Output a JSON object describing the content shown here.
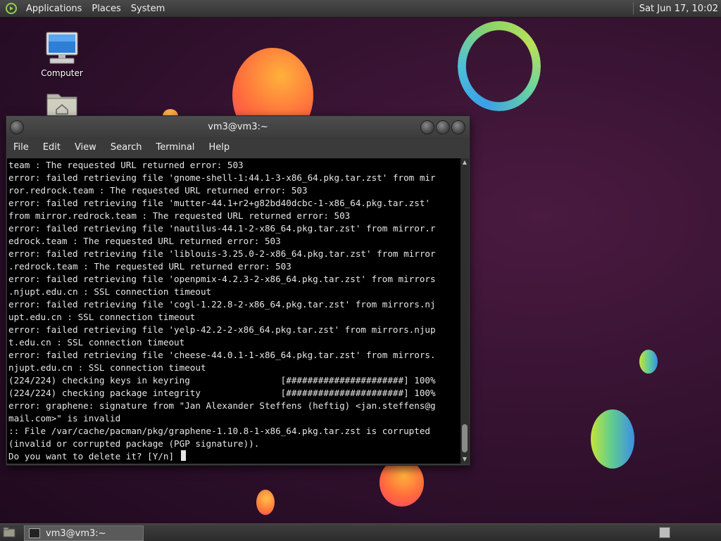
{
  "top_panel": {
    "menus": [
      "Applications",
      "Places",
      "System"
    ],
    "clock": "Sat Jun 17, 10:02"
  },
  "desktop_icons": [
    {
      "label": "Computer",
      "icon": "computer-icon"
    },
    {
      "label": "",
      "icon": "home-folder-icon"
    }
  ],
  "terminal": {
    "title": "vm3@vm3:~",
    "menu": [
      "File",
      "Edit",
      "View",
      "Search",
      "Terminal",
      "Help"
    ],
    "lines": [
      "team : The requested URL returned error: 503",
      "error: failed retrieving file 'gnome-shell-1:44.1-3-x86_64.pkg.tar.zst' from mir",
      "ror.redrock.team : The requested URL returned error: 503",
      "error: failed retrieving file 'mutter-44.1+r2+g82bd40dcbc-1-x86_64.pkg.tar.zst'",
      "from mirror.redrock.team : The requested URL returned error: 503",
      "error: failed retrieving file 'nautilus-44.1-2-x86_64.pkg.tar.zst' from mirror.r",
      "edrock.team : The requested URL returned error: 503",
      "error: failed retrieving file 'liblouis-3.25.0-2-x86_64.pkg.tar.zst' from mirror",
      ".redrock.team : The requested URL returned error: 503",
      "error: failed retrieving file 'openpmix-4.2.3-2-x86_64.pkg.tar.zst' from mirrors",
      ".njupt.edu.cn : SSL connection timeout",
      "error: failed retrieving file 'cogl-1.22.8-2-x86_64.pkg.tar.zst' from mirrors.nj",
      "upt.edu.cn : SSL connection timeout",
      "error: failed retrieving file 'yelp-42.2-2-x86_64.pkg.tar.zst' from mirrors.njup",
      "t.edu.cn : SSL connection timeout",
      "error: failed retrieving file 'cheese-44.0.1-1-x86_64.pkg.tar.zst' from mirrors.",
      "njupt.edu.cn : SSL connection timeout",
      "(224/224) checking keys in keyring                 [######################] 100%",
      "(224/224) checking package integrity               [######################] 100%",
      "error: graphene: signature from \"Jan Alexander Steffens (heftig) <jan.steffens@g",
      "mail.com>\" is invalid",
      ":: File /var/cache/pacman/pkg/graphene-1.10.8-1-x86_64.pkg.tar.zst is corrupted",
      "(invalid or corrupted package (PGP signature)).",
      "Do you want to delete it? [Y/n] "
    ]
  },
  "bottom_panel": {
    "task_label": "vm3@vm3:~"
  }
}
